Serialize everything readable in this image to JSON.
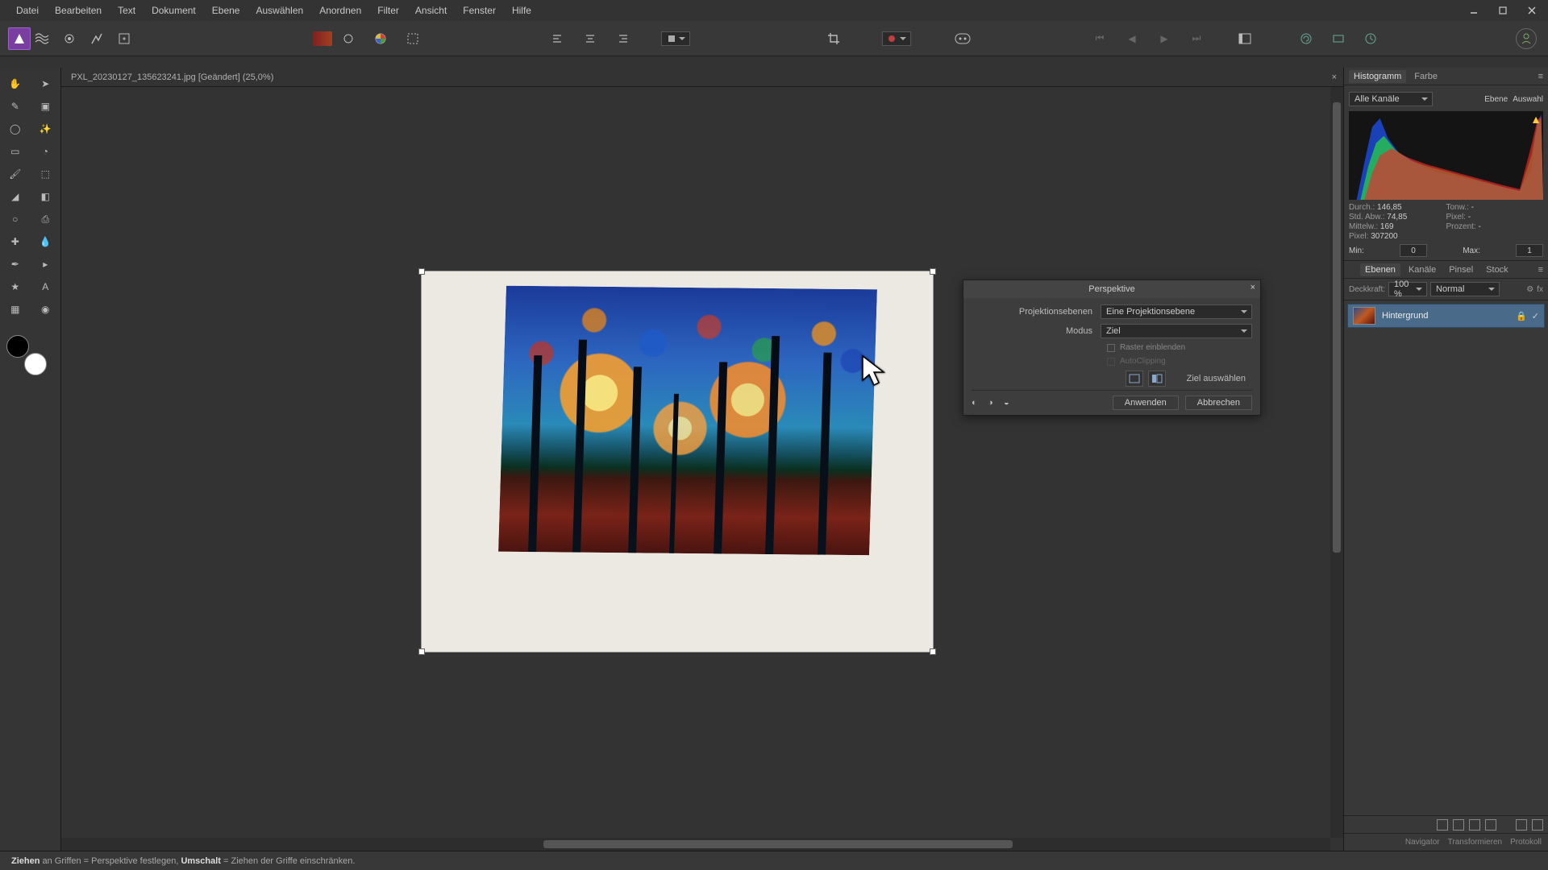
{
  "menu": [
    "Datei",
    "Bearbeiten",
    "Text",
    "Dokument",
    "Ebene",
    "Auswählen",
    "Anordnen",
    "Filter",
    "Ansicht",
    "Fenster",
    "Hilfe"
  ],
  "document": {
    "tab_label": "PXL_20230127_135623241.jpg [Geändert] (25,0%)"
  },
  "histogram": {
    "tab1": "Histogramm",
    "tab2": "Farbe",
    "channels": "Alle Kanäle",
    "right_a": "Ebene",
    "right_b": "Auswahl",
    "stats": {
      "durch_l": "Durch.:",
      "durch_v": "146,85",
      "tonw_l": "Tonw.:",
      "tonw_v": "-",
      "std_l": "Std. Abw.:",
      "std_v": "74,85",
      "pixel2_l": "Pixel:",
      "pixel2_v": "-",
      "mittelw_l": "Mittelw.:",
      "mittelw_v": "169",
      "proz_l": "Prozent:",
      "proz_v": "-",
      "pixel_l": "Pixel:",
      "pixel_v": "307200"
    },
    "min_l": "Min:",
    "min_v": "0",
    "max_l": "Max:",
    "max_v": "1"
  },
  "layers": {
    "tabs": [
      "Ebenen",
      "Kanäle",
      "Pinsel",
      "Stock"
    ],
    "opacity_l": "Deckkraft:",
    "opacity_v": "100 %",
    "blend": "Normal",
    "item": "Hintergrund"
  },
  "navtabs": [
    "Navigator",
    "Transformieren",
    "Protokoll"
  ],
  "dialog": {
    "title": "Perspektive",
    "planes_l": "Projektionsebenen",
    "planes_v": "Eine Projektionsebene",
    "mode_l": "Modus",
    "mode_v": "Ziel",
    "grid": "Raster einblenden",
    "autoclip": "AutoClipping",
    "ziel": "Ziel auswählen",
    "apply": "Anwenden",
    "cancel": "Abbrechen"
  },
  "status": {
    "b1": "Ziehen",
    "t1": " an Griffen = Perspektive festlegen, ",
    "b2": "Umschalt",
    "t2": " = Ziehen der Griffe einschränken."
  }
}
